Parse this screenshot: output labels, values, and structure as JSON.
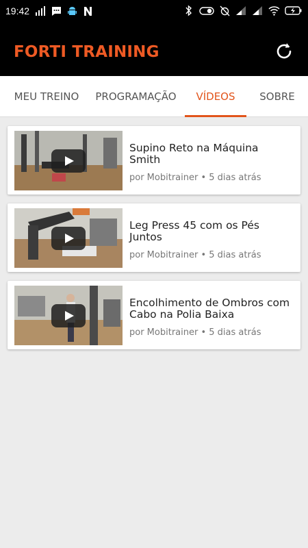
{
  "status_bar": {
    "time": "19:42",
    "left_icons": [
      "signal-bars-icon",
      "message-icon",
      "android-icon",
      "n-icon"
    ],
    "right_icons": [
      "bluetooth-icon",
      "toggle-icon",
      "alarm-off-icon",
      "signal-icon",
      "signal-icon",
      "wifi-icon",
      "battery-charging-icon"
    ]
  },
  "app_bar": {
    "title": "FORTI TRAINING",
    "title_color": "#ee5a24",
    "refresh_icon": "refresh-icon"
  },
  "tabs": [
    {
      "label": "MEU TREINO",
      "active": false
    },
    {
      "label": "PROGRAMAÇÃO",
      "active": false
    },
    {
      "label": "VÍDEOS",
      "active": true
    },
    {
      "label": "SOBRE",
      "active": false
    }
  ],
  "accent_color": "#e2541b",
  "videos": [
    {
      "title": "Supino Reto na Máquina Smith",
      "meta": "por Mobitrainer • 5 dias atrás"
    },
    {
      "title": "Leg Press 45 com os Pés Juntos",
      "meta": "por Mobitrainer • 5 dias atrás"
    },
    {
      "title": "Encolhimento de Ombros com Cabo na Polia Baixa",
      "meta": "por Mobitrainer • 5 dias atrás"
    }
  ]
}
